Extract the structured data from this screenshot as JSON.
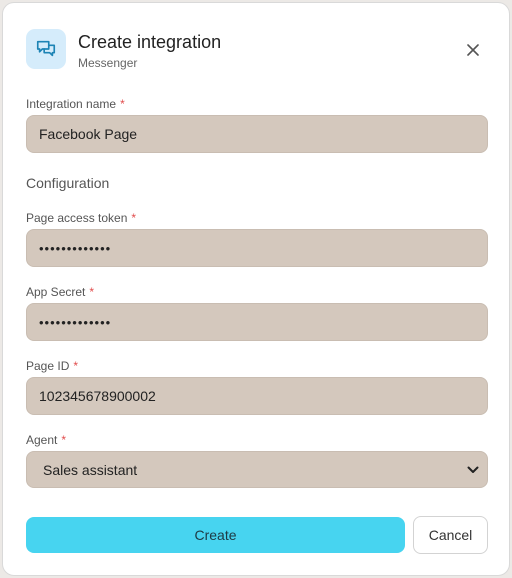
{
  "dialog": {
    "title": "Create integration",
    "subtitle": "Messenger",
    "icon": "messages-icon"
  },
  "form": {
    "required_mark": "*",
    "integration_name": {
      "label": "Integration name",
      "value": "Facebook Page"
    },
    "section_title": "Configuration",
    "page_access_token": {
      "label": "Page access token",
      "value": "•••••••••••••"
    },
    "app_secret": {
      "label": "App Secret",
      "value": "•••••••••••••"
    },
    "page_id": {
      "label": "Page ID",
      "value": "102345678900002"
    },
    "agent": {
      "label": "Agent",
      "value": "Sales assistant"
    }
  },
  "actions": {
    "create_label": "Create",
    "cancel_label": "Cancel"
  },
  "colors": {
    "field_bg": "#d4c8bd",
    "primary": "#47d4f0",
    "required": "#e14c4c",
    "icon_bg": "#d5ecfb"
  }
}
